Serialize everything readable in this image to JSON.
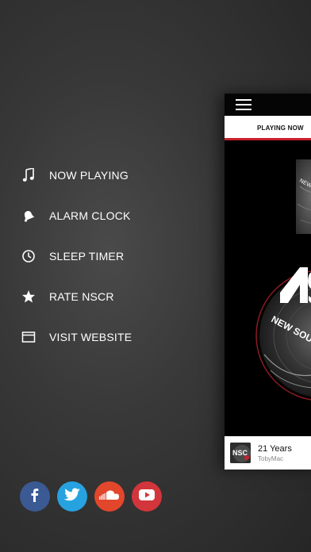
{
  "menu": {
    "items": [
      {
        "label": "NOW PLAYING",
        "icon": "music-note-icon"
      },
      {
        "label": "ALARM CLOCK",
        "icon": "alarm-bell-icon"
      },
      {
        "label": "SLEEP TIMER",
        "icon": "clock-icon"
      },
      {
        "label": "RATE NSCR",
        "icon": "star-icon"
      },
      {
        "label": "VISIT WEBSITE",
        "icon": "browser-window-icon"
      }
    ]
  },
  "social": {
    "items": [
      {
        "name": "facebook",
        "icon": "facebook-icon",
        "color": "#3b5a94"
      },
      {
        "name": "twitter",
        "icon": "twitter-icon",
        "color": "#27a2e0"
      },
      {
        "name": "soundcloud",
        "icon": "soundcloud-icon",
        "color": "#e2472c"
      },
      {
        "name": "youtube",
        "icon": "youtube-icon",
        "color": "#d2353b"
      }
    ]
  },
  "panel": {
    "tab_label": "PLAYING NOW",
    "accent_color": "#c8202b",
    "logo_text": "NEW SOUND",
    "now_playing": {
      "song": "21 Years",
      "artist": "TobyMac"
    }
  }
}
